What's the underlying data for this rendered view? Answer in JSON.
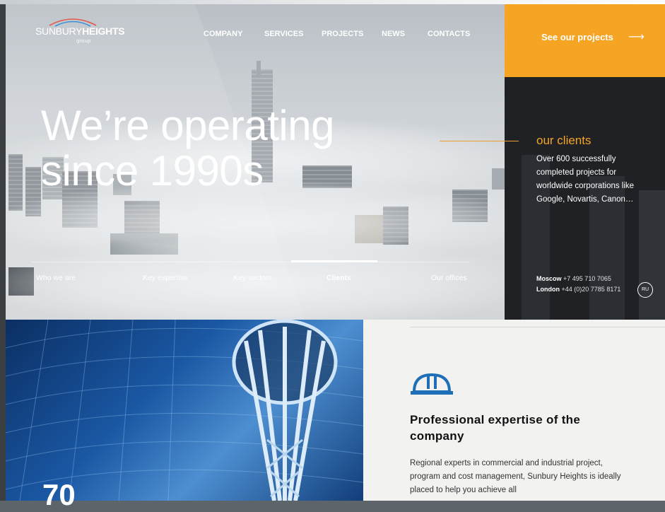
{
  "brand": {
    "name_light": "SUNBURY",
    "name_bold": "HEIGHTS",
    "sub": "group"
  },
  "nav": [
    {
      "label": "COMPANY"
    },
    {
      "label": "SERVICES"
    },
    {
      "label": "PROJECTS"
    },
    {
      "label": "NEWS"
    },
    {
      "label": "CONTACTS"
    }
  ],
  "cta": {
    "label": "See our projects",
    "arrow": "⟶"
  },
  "hero": {
    "title_line1": "We’re operating",
    "title_line2": "since 1990s"
  },
  "tabs": [
    {
      "label": "Who we are",
      "active": false
    },
    {
      "label": "Key expertise",
      "active": false
    },
    {
      "label": "Key sectors",
      "active": false
    },
    {
      "label": "Clients",
      "active": true
    },
    {
      "label": "Our offices",
      "active": false
    }
  ],
  "clients": {
    "title": "our clients",
    "text": "Over 600 successfully completed projects for worldwide corporations like Google, Novartis, Canon…"
  },
  "contacts": [
    {
      "city": "Moscow",
      "phone": "+7 495 710 7065"
    },
    {
      "city": "London",
      "phone": "+44 (0)20 7785 8171"
    }
  ],
  "language": "RU",
  "expertise": {
    "title": "Professional expertise of the company",
    "text": "Regional experts in commercial and industrial project, program and cost management, Sunbury Heights is ideally placed to help you achieve all"
  },
  "stat_partial": "70",
  "colors": {
    "accent": "#f5a523",
    "dark": "#1f2124",
    "icon": "#1f6fb8"
  },
  "icons": {
    "helmet": "hard-hat-icon",
    "arrow": "arrow-right-icon"
  }
}
